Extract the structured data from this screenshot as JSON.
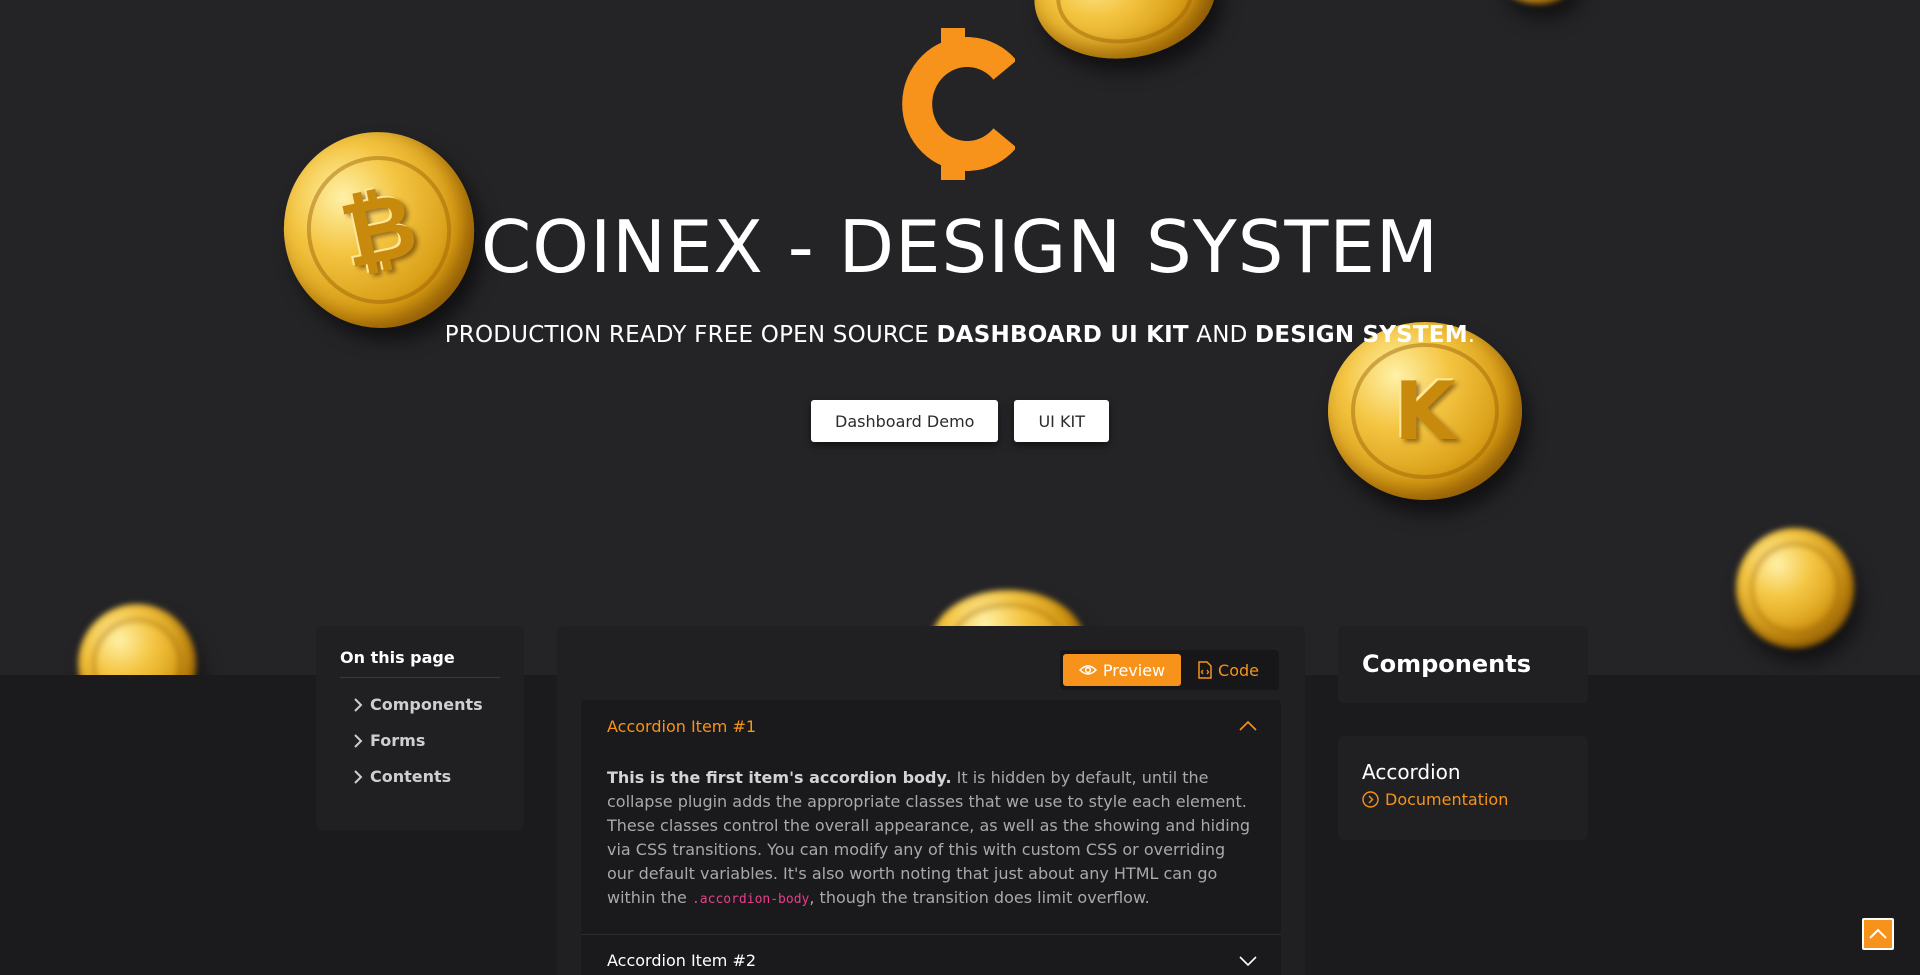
{
  "hero": {
    "title": "COINEX - DESIGN SYSTEM",
    "subtitle_part1": "PRODUCTION READY FREE OPEN SOURCE ",
    "subtitle_bold1": "DASHBOARD UI KIT",
    "subtitle_part2": " AND ",
    "subtitle_bold2": "DESIGN SYSTEM",
    "subtitle_end": ".",
    "buttons": {
      "dashboard_demo": "Dashboard Demo",
      "ui_kit": "UI KIT"
    },
    "logo_icon": "coinex-logo-icon",
    "coin_glyphs": [
      "bitcoin",
      "kinesis",
      "coin-partial"
    ]
  },
  "toc": {
    "title": "On this page",
    "items": [
      "Components",
      "Forms",
      "Contents"
    ]
  },
  "main": {
    "toggle": {
      "preview": "Preview",
      "code": "Code"
    },
    "accordion": {
      "item1_title": "Accordion Item #1",
      "item1_body_strong": "This is the first item's accordion body.",
      "item1_body_text": " It is hidden by default, until the collapse plugin adds the appropriate classes that we use to style each element. These classes control the overall appearance, as well as the showing and hiding via CSS transitions. You can modify any of this with custom CSS or overriding our default variables. It's also worth noting that just about any HTML can go within the ",
      "item1_body_code": ".accordion-body",
      "item1_body_end": ", though the transition does limit overflow.",
      "item2_title": "Accordion Item #2"
    }
  },
  "sidebar_right": {
    "components_heading": "Components",
    "accordion_heading": "Accordion",
    "documentation_link": "Documentation"
  },
  "colors": {
    "accent": "#f7931a",
    "hero_bg": "#242427",
    "page_bg": "#1b1b1d",
    "card_bg": "#202023",
    "code_pink": "#e83e8c"
  }
}
